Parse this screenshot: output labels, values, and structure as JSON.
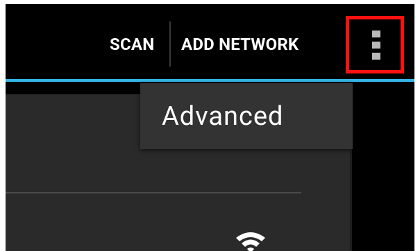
{
  "actionbar": {
    "scan_label": "SCAN",
    "add_network_label": "ADD NETWORK"
  },
  "overflow_menu": {
    "items": [
      {
        "label": "Advanced"
      }
    ]
  },
  "icons": {
    "overflow": "overflow-menu-icon",
    "wifi": "wifi-signal-icon"
  },
  "colors": {
    "accent": "#33b5e5",
    "highlight": "#ff1111",
    "background": "#000000",
    "popup": "#333333"
  }
}
